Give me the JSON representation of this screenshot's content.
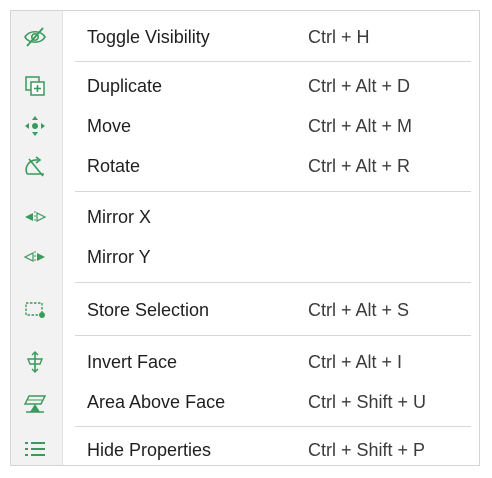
{
  "menu": {
    "accent_color": "#3a9a5c",
    "items": [
      {
        "icon": "eye-slash-icon",
        "label": "Toggle Visibility",
        "shortcut": "Ctrl + H"
      },
      {
        "icon": "duplicate-icon",
        "label": "Duplicate",
        "shortcut": "Ctrl + Alt + D"
      },
      {
        "icon": "move-arrows-icon",
        "label": "Move",
        "shortcut": "Ctrl + Alt + M"
      },
      {
        "icon": "rotate-icon",
        "label": "Rotate",
        "shortcut": "Ctrl + Alt + R"
      },
      {
        "icon": "mirror-x-icon",
        "label": "Mirror X",
        "shortcut": ""
      },
      {
        "icon": "mirror-y-icon",
        "label": "Mirror Y",
        "shortcut": ""
      },
      {
        "icon": "store-selection-icon",
        "label": "Store Selection",
        "shortcut": "Ctrl + Alt + S"
      },
      {
        "icon": "invert-face-icon",
        "label": "Invert Face",
        "shortcut": "Ctrl + Alt + I"
      },
      {
        "icon": "area-above-face-icon",
        "label": "Area Above Face",
        "shortcut": "Ctrl + Shift + U"
      },
      {
        "icon": "list-icon",
        "label": "Hide Properties",
        "shortcut": "Ctrl + Shift + P"
      }
    ]
  }
}
